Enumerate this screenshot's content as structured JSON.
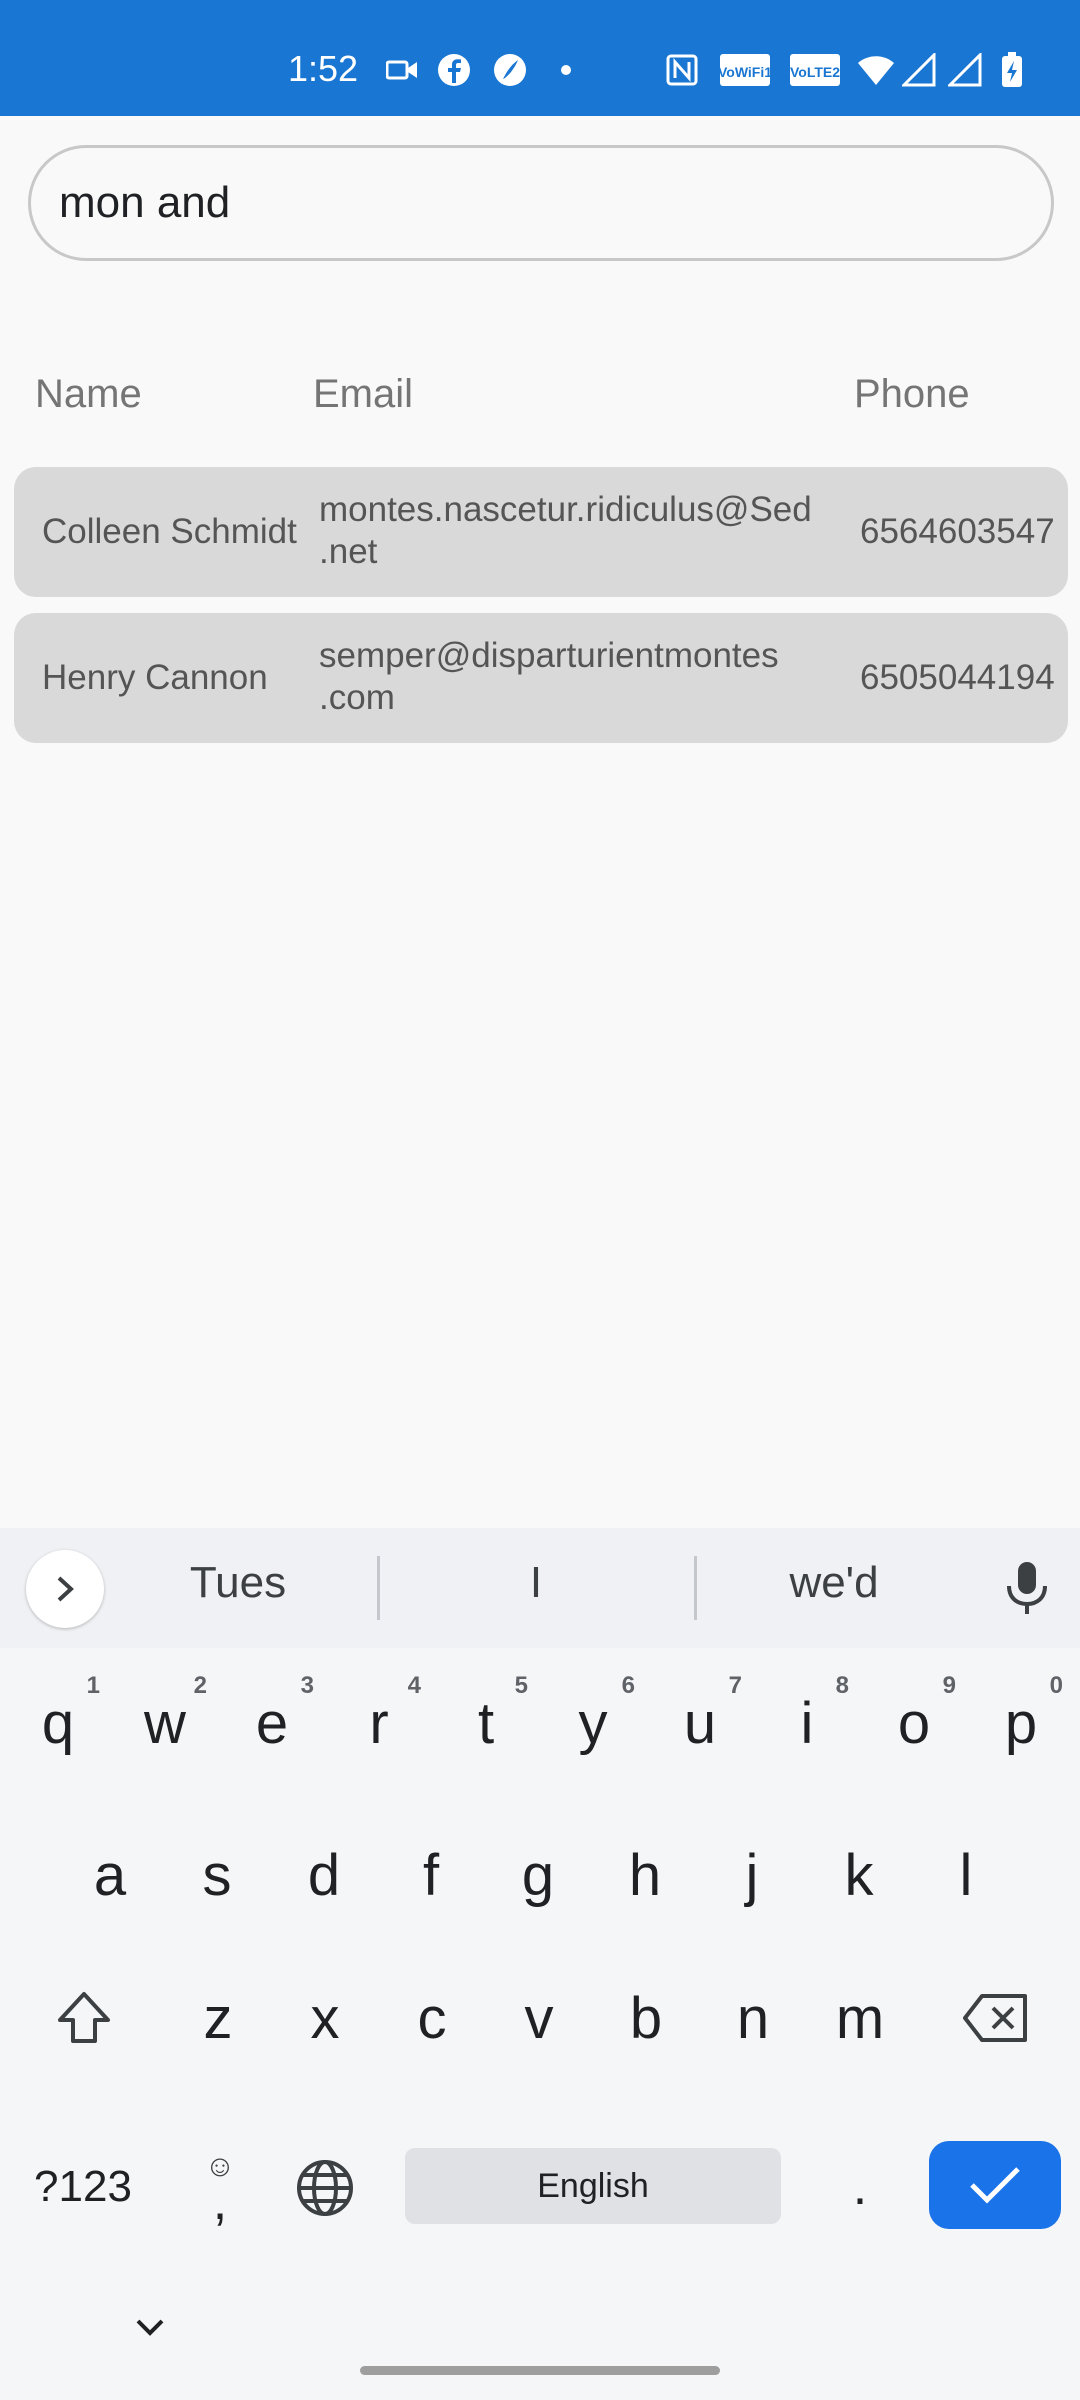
{
  "status_bar": {
    "time": "1:52",
    "icons": [
      "video-camera-icon",
      "facebook-icon",
      "feather-app-icon",
      "notification-dot-icon",
      "nfc-icon",
      "vowifi-icon",
      "volte2-icon",
      "wifi-icon",
      "signal-icon",
      "signal2-icon",
      "battery-charging-icon"
    ],
    "wifi_badge": "VoWiFi1",
    "lte_badge": "VoLTE2",
    "background": "#1976d2"
  },
  "search": {
    "value": "mon and",
    "placeholder": ""
  },
  "table": {
    "headers": {
      "name": "Name",
      "email": "Email",
      "phone": "Phone"
    },
    "rows": [
      {
        "name": "Colleen Schmidt",
        "email_line1": "montes.nascetur.ridiculus@Sed",
        "email_line2": ".net",
        "phone": "6564603547"
      },
      {
        "name": "Henry Cannon",
        "email_line1": "semper@disparturientmontes",
        "email_line2": ".com",
        "phone": "6505044194"
      }
    ]
  },
  "keyboard": {
    "suggestions": [
      "Tues",
      "I",
      "we'd"
    ],
    "row1": [
      {
        "key": "q",
        "hint": "1"
      },
      {
        "key": "w",
        "hint": "2"
      },
      {
        "key": "e",
        "hint": "3"
      },
      {
        "key": "r",
        "hint": "4"
      },
      {
        "key": "t",
        "hint": "5"
      },
      {
        "key": "y",
        "hint": "6"
      },
      {
        "key": "u",
        "hint": "7"
      },
      {
        "key": "i",
        "hint": "8"
      },
      {
        "key": "o",
        "hint": "9"
      },
      {
        "key": "p",
        "hint": "0"
      }
    ],
    "row2": [
      "a",
      "s",
      "d",
      "f",
      "g",
      "h",
      "j",
      "k",
      "l"
    ],
    "row3": [
      "z",
      "x",
      "c",
      "v",
      "b",
      "n",
      "m"
    ],
    "symbols_label": "?123",
    "comma_label": ",",
    "emoji_label": "☺",
    "space_label": "English",
    "period_label": ".",
    "accent": "#1a73e8"
  }
}
